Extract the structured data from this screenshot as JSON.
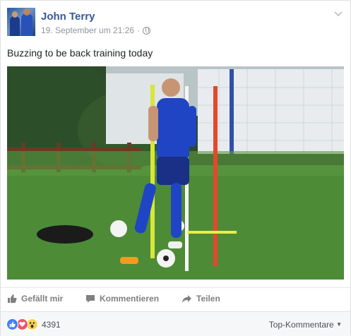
{
  "post": {
    "author": "John Terry",
    "timestamp": "19. September um 21:26",
    "separator": "·",
    "privacy_icon": "globe-icon",
    "text": "Buzzing to be back training today",
    "photo_icon": "training-photo"
  },
  "actions": {
    "like_label": "Gefällt mir",
    "comment_label": "Kommentieren",
    "share_label": "Teilen"
  },
  "reactions": {
    "types": [
      "like",
      "love",
      "wow"
    ],
    "count": "4391"
  },
  "comments": {
    "sort_label": "Top-Kommentare"
  },
  "colors": {
    "brand_link": "#365899",
    "meta_gray": "#90949c",
    "action_gray": "#7f7f7f",
    "like_blue": "#4080ff",
    "love_red": "#f25268",
    "wow_yellow": "#fcd34c"
  }
}
